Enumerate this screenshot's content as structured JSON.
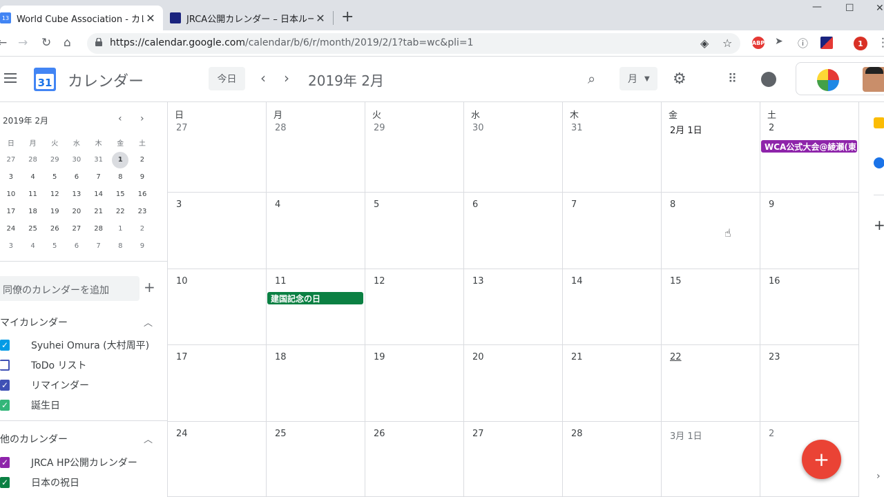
{
  "browser": {
    "tabs": [
      {
        "title": "World Cube Association - カレンダ",
        "favicon": "13",
        "active": true
      },
      {
        "title": "JRCA公開カレンダー – 日本ルービック",
        "favicon": "JRCA",
        "active": false
      }
    ],
    "url_base": "https://calendar.google.com",
    "url_path": "/calendar/b/6/r/month/2019/2/1?tab=wc&pli=1",
    "extensions": {
      "abp": "ABP",
      "badge": "1"
    }
  },
  "header": {
    "app_name": "カレンダー",
    "logo_day": "31",
    "today_label": "今日",
    "current_period": "2019年 2月",
    "view_label": "月"
  },
  "sidebar": {
    "mini_title": "2019年 2月",
    "weekdays": [
      "日",
      "月",
      "火",
      "水",
      "木",
      "金",
      "土"
    ],
    "weeks": [
      [
        "27",
        "28",
        "29",
        "30",
        "31",
        "1",
        "2"
      ],
      [
        "3",
        "4",
        "5",
        "6",
        "7",
        "8",
        "9"
      ],
      [
        "10",
        "11",
        "12",
        "13",
        "14",
        "15",
        "16"
      ],
      [
        "17",
        "18",
        "19",
        "20",
        "21",
        "22",
        "23"
      ],
      [
        "24",
        "25",
        "26",
        "27",
        "28",
        "1",
        "2"
      ],
      [
        "3",
        "4",
        "5",
        "6",
        "7",
        "8",
        "9"
      ]
    ],
    "add_calendar_placeholder": "同僚のカレンダーを追加",
    "my_calendars_title": "マイカレンダー",
    "my_calendars": [
      {
        "name": "Syuhei Omura (大村周平)",
        "color": "#039be5",
        "checked": true
      },
      {
        "name": "ToDo リスト",
        "color": "#3f51b5",
        "checked": false
      },
      {
        "name": "リマインダー",
        "color": "#3f51b5",
        "checked": true
      },
      {
        "name": "誕生日",
        "color": "#33b679",
        "checked": true
      }
    ],
    "other_calendars_title": "他のカレンダー",
    "other_calendars": [
      {
        "name": "JRCA HP公開カレンダー",
        "color": "#8e24aa",
        "checked": true
      },
      {
        "name": "日本の祝日",
        "color": "#0b8043",
        "checked": true
      }
    ]
  },
  "month": {
    "weekdays": [
      "日",
      "月",
      "火",
      "水",
      "木",
      "金",
      "土"
    ],
    "weeks": [
      [
        "27",
        "28",
        "29",
        "30",
        "31",
        "2月 1日",
        "2"
      ],
      [
        "3",
        "4",
        "5",
        "6",
        "7",
        "8",
        "9"
      ],
      [
        "10",
        "11",
        "12",
        "13",
        "14",
        "15",
        "16"
      ],
      [
        "17",
        "18",
        "19",
        "20",
        "21",
        "22",
        "23"
      ],
      [
        "24",
        "25",
        "26",
        "27",
        "28",
        "3月 1日",
        "2"
      ]
    ],
    "events": [
      {
        "title": "WCA公式大会@綾瀬(東",
        "color": "#8e24aa"
      },
      {
        "title": "建国記念の日",
        "color": "#0b8043"
      }
    ]
  },
  "fab_label": "+"
}
